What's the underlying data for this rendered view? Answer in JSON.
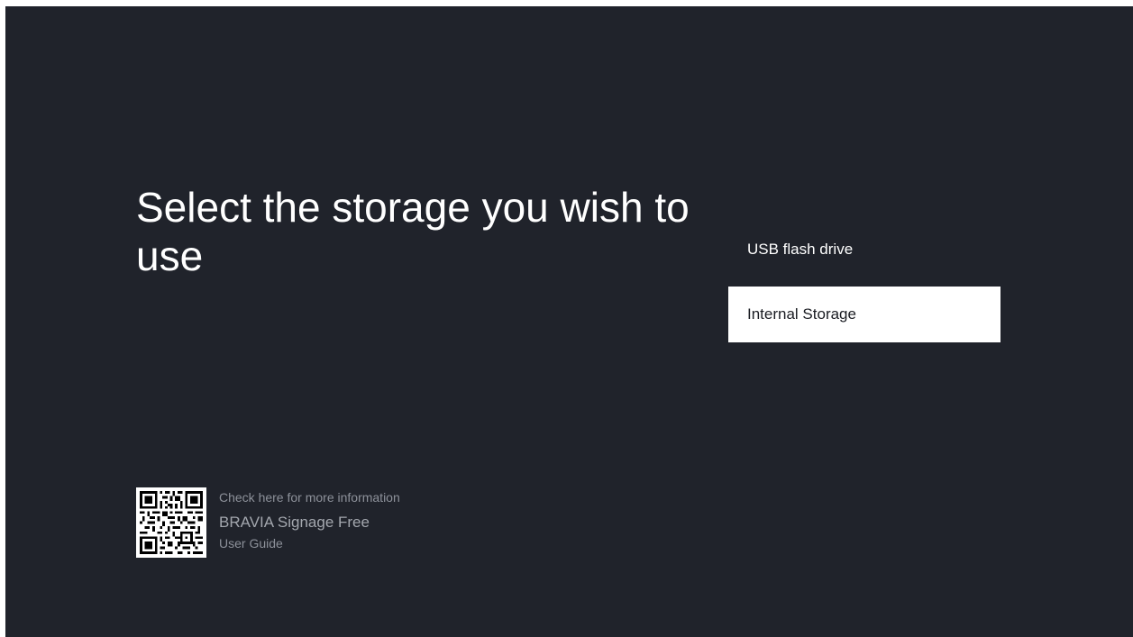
{
  "page": {
    "title": "Select the storage you wish to use"
  },
  "options": [
    {
      "label": "USB flash drive",
      "focused": false
    },
    {
      "label": "Internal Storage",
      "focused": true
    }
  ],
  "help": {
    "line1": "Check here for more information",
    "line2": "BRAVIA Signage Free",
    "line3": "User Guide",
    "icon": "qr-code-icon"
  },
  "colors": {
    "background": "#20232b",
    "focused_option_background": "#ffffff",
    "text_primary": "#ffffff",
    "text_secondary": "#8d919a"
  }
}
